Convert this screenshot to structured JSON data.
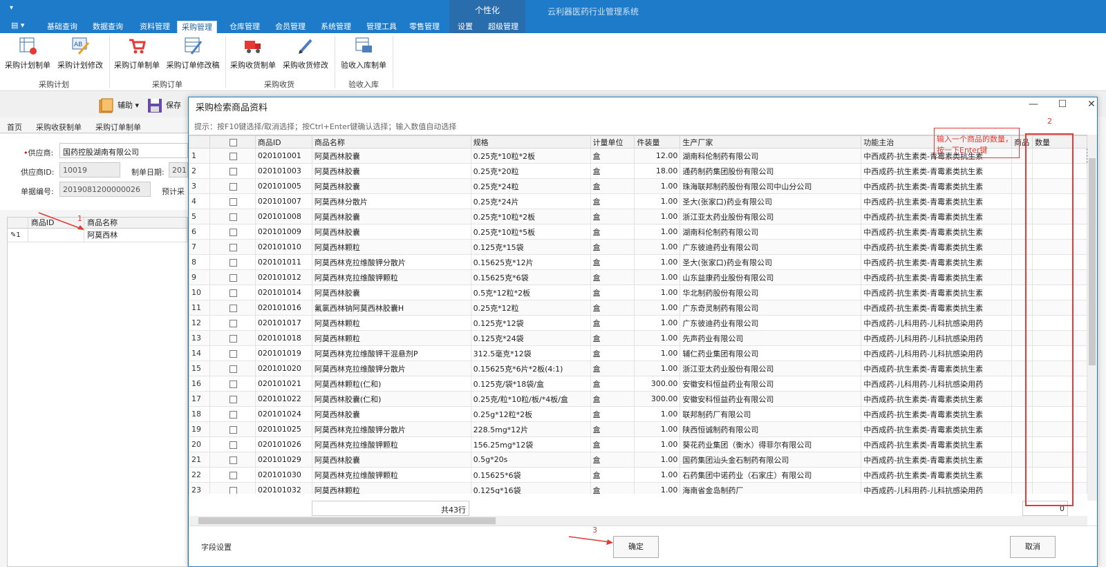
{
  "app": {
    "title": "云利器医药行业管理系统",
    "qat_icon": "▾",
    "context_tab": "个性化",
    "app_menu": "▤ ▾"
  },
  "ribbon_tabs": [
    "基础查询",
    "数据查询",
    "资料管理",
    "采购管理",
    "仓库管理",
    "会员管理",
    "系统管理",
    "管理工具",
    "零售管理",
    "设置",
    "超级管理"
  ],
  "ribbon_groups": [
    {
      "label": "采购计划",
      "buttons": [
        "采购计划制单",
        "采购计划修改"
      ]
    },
    {
      "label": "采购订单",
      "buttons": [
        "采购订单制单",
        "采购订单修改稿"
      ]
    },
    {
      "label": "采购收货",
      "buttons": [
        "采购收货制单",
        "采购收货修改"
      ]
    },
    {
      "label": "验收入库",
      "buttons": [
        "验收入库制单"
      ]
    }
  ],
  "toolbar": {
    "assist": "辅助",
    "save": "保存"
  },
  "doc_tabs": [
    "首页",
    "采购收获制单",
    "采购订单制单"
  ],
  "form": {
    "supplier_label": "供应商:",
    "supplier_required": "•",
    "supplier_value": "国药控股湖南有限公司",
    "supplier_id_label": "供应商ID:",
    "supplier_id_value": "10019",
    "date_label": "制单日期:",
    "date_value": "201",
    "doc_no_label": "单据编号:",
    "doc_no_value": "2019081200000026",
    "estimate_label": "预计采"
  },
  "bg_grid": {
    "headers": [
      "商品ID",
      "商品名称"
    ],
    "row_marker": "✎1",
    "row_name": "阿莫西林"
  },
  "dialog": {
    "title": "采购检索商品资料",
    "hint": "提示：按F10键选择/取消选择；按Ctrl+Enter键确认选择；输入数值自动选择",
    "minimize": "—",
    "maximize": "☐",
    "close": "✕",
    "columns": [
      "",
      "",
      "商品ID",
      "商品名称",
      "规格",
      "计量单位",
      "件装量",
      "生产厂家",
      "功能主治",
      "商品",
      "数量"
    ],
    "rows": [
      [
        "1",
        "020101001",
        "阿莫西林胶囊",
        "0.25克*10粒*2板",
        "盒",
        "12.00",
        "湖南科伦制药有限公司",
        "中西成药-抗生素类-青霉素类抗生素"
      ],
      [
        "2",
        "020101003",
        "阿莫西林胶囊",
        "0.25克*20粒",
        "盒",
        "18.00",
        "通药制药集团股份有限公司",
        "中西成药-抗生素类-青霉素类抗生素"
      ],
      [
        "3",
        "020101005",
        "阿莫西林胶囊",
        "0.25克*24粒",
        "盒",
        "1.00",
        "珠海联邦制药股份有限公司中山分公司",
        "中西成药-抗生素类-青霉素类抗生素"
      ],
      [
        "4",
        "020101007",
        "阿莫西林分散片",
        "0.25克*24片",
        "盒",
        "1.00",
        "圣大(张家口)药业有限公司",
        "中西成药-抗生素类-青霉素类抗生素"
      ],
      [
        "5",
        "020101008",
        "阿莫西林胶囊",
        "0.25克*10粒*2板",
        "盒",
        "1.00",
        "浙江亚太药业股份有限公司",
        "中西成药-抗生素类-青霉素类抗生素"
      ],
      [
        "6",
        "020101009",
        "阿莫西林胶囊",
        "0.25克*10粒*5板",
        "盒",
        "1.00",
        "湖南科伦制药有限公司",
        "中西成药-抗生素类-青霉素类抗生素"
      ],
      [
        "7",
        "020101010",
        "阿莫西林颗粒",
        "0.125克*15袋",
        "盒",
        "1.00",
        "广东彼迪药业有限公司",
        "中西成药-抗生素类-青霉素类抗生素"
      ],
      [
        "8",
        "020101011",
        "阿莫西林克拉维酸钾分散片",
        "0.15625克*12片",
        "盒",
        "1.00",
        "圣大(张家口)药业有限公司",
        "中西成药-抗生素类-青霉素类抗生素"
      ],
      [
        "9",
        "020101012",
        "阿莫西林克拉维酸钾颗粒",
        "0.15625克*6袋",
        "盒",
        "1.00",
        "山东益康药业股份有限公司",
        "中西成药-抗生素类-青霉素类抗生素"
      ],
      [
        "10",
        "020101014",
        "阿莫西林胶囊",
        "0.5克*12粒*2板",
        "盒",
        "1.00",
        "华北制药股份有限公司",
        "中西成药-抗生素类-青霉素类抗生素"
      ],
      [
        "11",
        "020101016",
        "氟氯西林钠阿莫西林胶囊H",
        "0.25克*12粒",
        "盒",
        "1.00",
        "广东奇灵制药有限公司",
        "中西成药-抗生素类-青霉素类抗生素"
      ],
      [
        "12",
        "020101017",
        "阿莫西林颗粒",
        "0.125克*12袋",
        "盒",
        "1.00",
        "广东彼迪药业有限公司",
        "中西成药-儿科用药-儿科抗感染用药"
      ],
      [
        "13",
        "020101018",
        "阿莫西林颗粒",
        "0.125克*24袋",
        "盒",
        "1.00",
        "先声药业有限公司",
        "中西成药-儿科用药-儿科抗感染用药"
      ],
      [
        "14",
        "020101019",
        "阿莫西林克拉维酸钾干混悬剂P",
        "312.5毫克*12袋",
        "盒",
        "1.00",
        "辅仁药业集团有限公司",
        "中西成药-儿科用药-儿科抗感染用药"
      ],
      [
        "15",
        "020101020",
        "阿莫西林克拉维酸钾分散片",
        "0.15625克*6片*2板(4:1)",
        "盒",
        "1.00",
        "浙江亚太药业股份有限公司",
        "中西成药-抗生素类-青霉素类抗生素"
      ],
      [
        "16",
        "020101021",
        "阿莫西林颗粒(仁和)",
        "0.125克/袋*18袋/盒",
        "盒",
        "300.00",
        "安徽安科恒益药业有限公司",
        "中西成药-儿科用药-儿科抗感染用药"
      ],
      [
        "17",
        "020101022",
        "阿莫西林胶囊(仁和)",
        "0.25克/粒*10粒/板/*4板/盒",
        "盒",
        "300.00",
        "安徽安科恒益药业有限公司",
        "中西成药-抗生素类-青霉素类抗生素"
      ],
      [
        "18",
        "020101024",
        "阿莫西林胶囊",
        "0.25g*12粒*2板",
        "盒",
        "1.00",
        "联邦制药厂有限公司",
        "中西成药-抗生素类-青霉素类抗生素"
      ],
      [
        "19",
        "020101025",
        "阿莫西林克拉维酸钾分散片",
        "228.5mg*12片",
        "盒",
        "1.00",
        "陕西恒诚制药有限公司",
        "中西成药-抗生素类-青霉素类抗生素"
      ],
      [
        "20",
        "020101026",
        "阿莫西林克拉维酸钾颗粒",
        "156.25mg*12袋",
        "盒",
        "1.00",
        "葵花药业集团（衡水）得菲尔有限公司",
        "中西成药-抗生素类-青霉素类抗生素"
      ],
      [
        "21",
        "020101029",
        "阿莫西林胶囊",
        "0.5g*20s",
        "盒",
        "1.00",
        "国药集团汕头金石制药有限公司",
        "中西成药-抗生素类-青霉素类抗生素"
      ],
      [
        "22",
        "020101030",
        "阿莫西林克拉维酸钾颗粒",
        "0.15625*6袋",
        "盒",
        "1.00",
        "石药集团中诺药业（石家庄）有限公司",
        "中西成药-抗生素类-青霉素类抗生素"
      ],
      [
        "23",
        "020101032",
        "阿莫西林颗粒",
        "0.125g*16袋",
        "盒",
        "1.00",
        "海南省金岛制药厂",
        "中西成药-儿科用药-儿科抗感染用药"
      ]
    ],
    "row_count": "共43行",
    "qty_sum": "0",
    "field_settings": "字段设置",
    "ok": "确定",
    "cancel": "取消"
  },
  "annotations": {
    "marker1": "1",
    "marker2": "2",
    "marker3": "3",
    "note_line1": "输入一个商品的数量，",
    "note_line2": "按一下Enter键"
  }
}
